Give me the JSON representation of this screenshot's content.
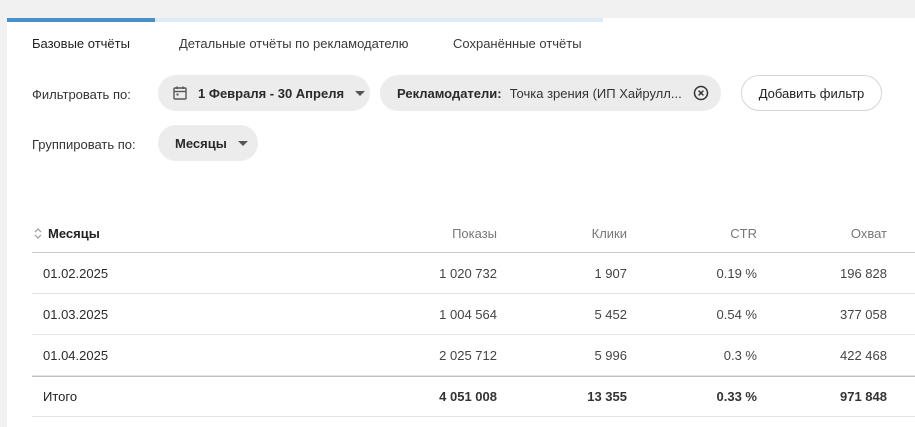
{
  "tabs": [
    {
      "label": "Базовые отчёты",
      "active": true
    },
    {
      "label": "Детальные отчёты по рекламодателю",
      "active": false
    },
    {
      "label": "Сохранённые отчёты",
      "active": false
    }
  ],
  "filters": {
    "filter_label": "Фильтровать по:",
    "date_range": "1 Февраля - 30 Апреля",
    "advertiser_label": "Рекламодатели:",
    "advertiser_value": "Точка зрения (ИП Хайрулл...",
    "add_filter": "Добавить фильтр",
    "group_label": "Группировать по:",
    "group_value": "Месяцы"
  },
  "table": {
    "columns": [
      "Месяцы",
      "Показы",
      "Клики",
      "CTR",
      "Охват"
    ],
    "rows": [
      [
        "01.02.2025",
        "1 020 732",
        "1 907",
        "0.19 %",
        "196 828"
      ],
      [
        "01.03.2025",
        "1 004 564",
        "5 452",
        "0.54 %",
        "377 058"
      ],
      [
        "01.04.2025",
        "2 025 712",
        "5 996",
        "0.3 %",
        "422 468"
      ]
    ],
    "total": [
      "Итого",
      "4 051 008",
      "13 355",
      "0.33 %",
      "971 848"
    ]
  },
  "colors": {
    "accent": "#4a90c8",
    "tab_inactive_bar": "#dcebf6",
    "chip_bg": "#ececec"
  },
  "icons": {
    "date": "calendar-icon",
    "advertiser_clear": "close-circle-icon",
    "dropdown": "caret-down-icon",
    "sort": "sort-icon"
  }
}
